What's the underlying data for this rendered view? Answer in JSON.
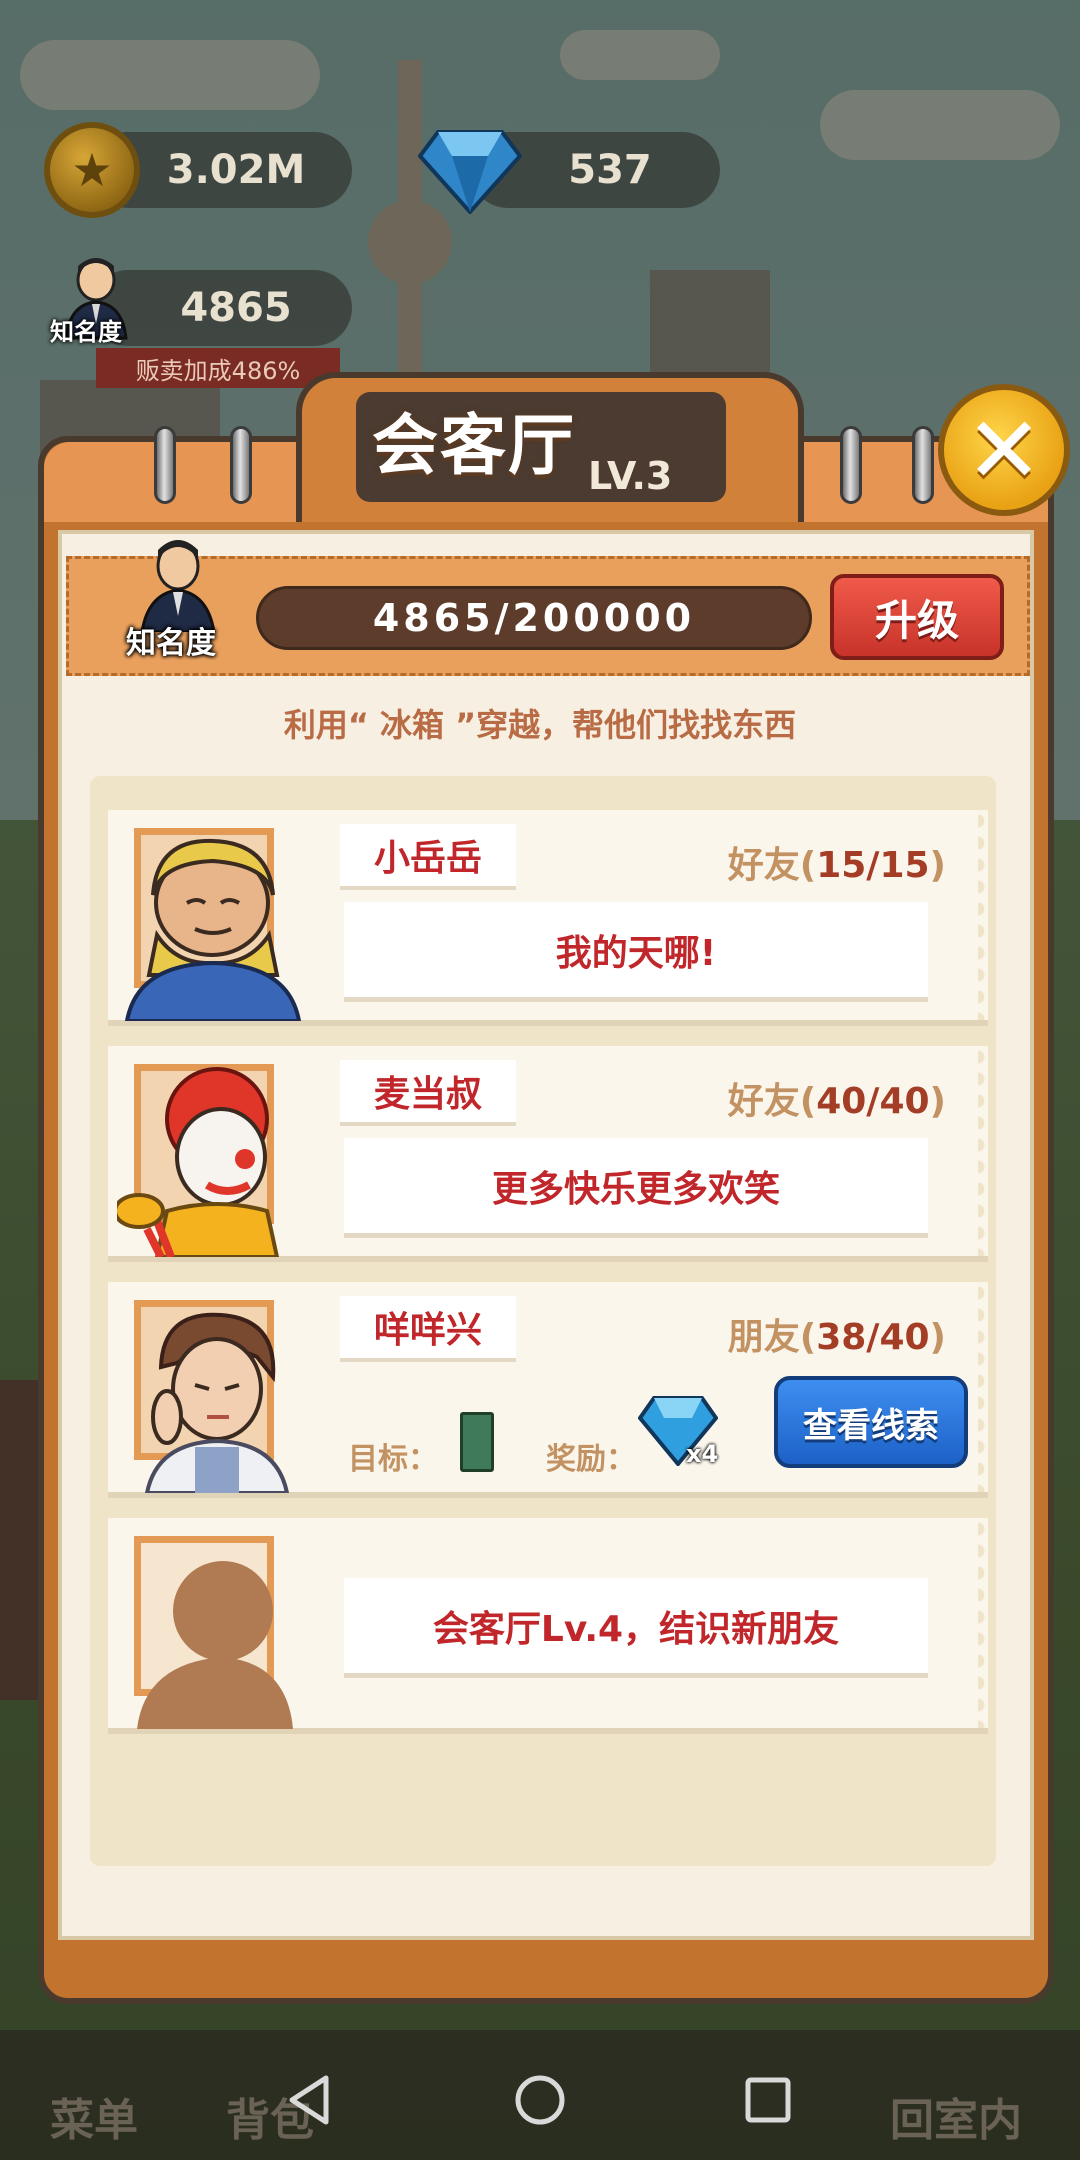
{
  "hud": {
    "coins": "3.02M",
    "gems": "537",
    "fame": "4865",
    "fame_label": "知名度",
    "sales_bonus": "贩卖加成486%"
  },
  "panel": {
    "title": "会客厅",
    "level": "LV.3",
    "fame_label": "知名度",
    "fame_progress": "4865/200000",
    "upgrade_label": "升级",
    "hint": "利用“ 冰箱 ”穿越，帮他们找找东西"
  },
  "guests": [
    {
      "name": "小岳岳",
      "relation_label": "好友",
      "relation_progress": "15/15",
      "quote": "我的天哪!"
    },
    {
      "name": "麦当叔",
      "relation_label": "好友",
      "relation_progress": "40/40",
      "quote": "更多快乐更多欢笑"
    },
    {
      "name": "咩咩兴",
      "relation_label": "朋友",
      "relation_progress": "38/40",
      "target_label": "目标：",
      "reward_label": "奖励：",
      "reward_count": "x4",
      "clue_button": "查看线索"
    },
    {
      "locked_text": "会客厅Lv.4，结识新朋友"
    }
  ],
  "bottom_nav": {
    "menu": "菜单",
    "bag": "背包",
    "back_indoor": "回室内"
  },
  "colors": {
    "panel_orange": "#c2732e",
    "accent_red": "#c0262a",
    "upgrade_red": "#e0443a",
    "clue_blue": "#2b76dd"
  }
}
